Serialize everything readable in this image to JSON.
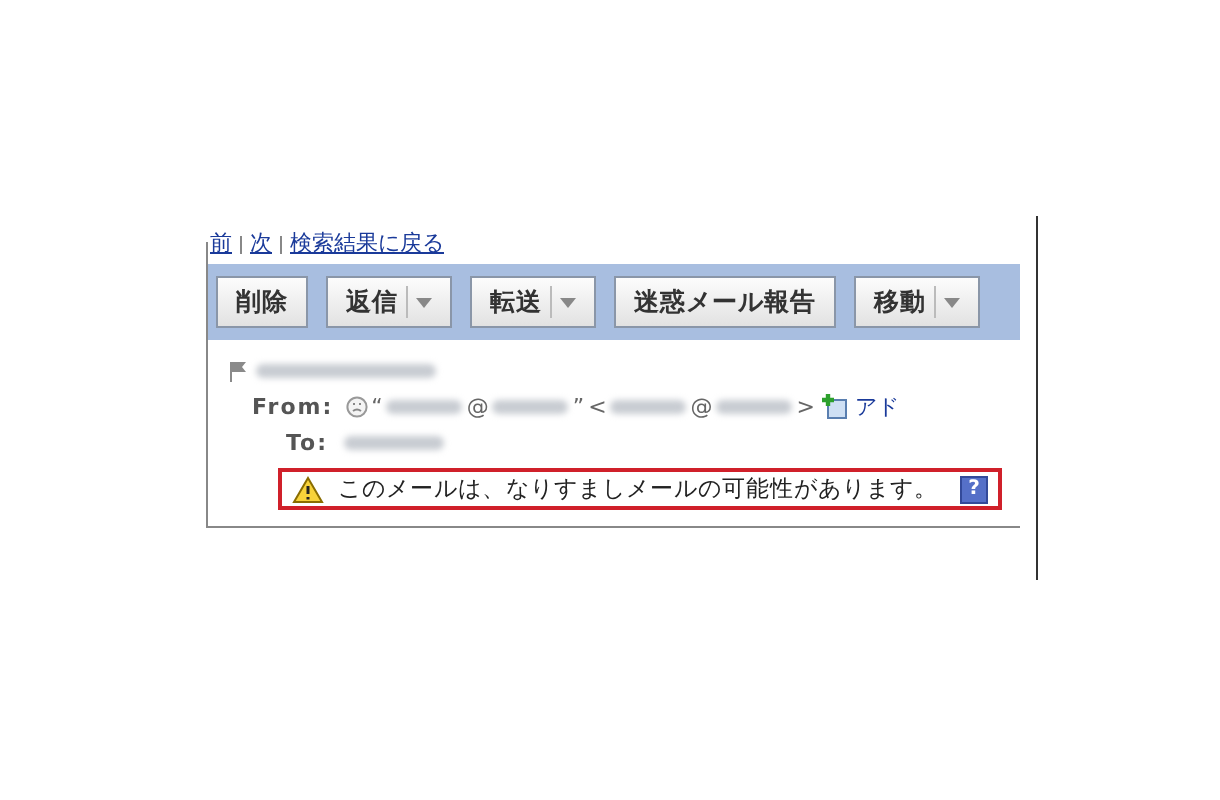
{
  "nav_links": [
    {
      "label": "前"
    },
    {
      "label": "次"
    },
    {
      "label": "検索結果に戻る"
    }
  ],
  "toolbar": {
    "buttons": [
      {
        "label": "削除",
        "dropdown": false
      },
      {
        "label": "返信",
        "dropdown": true
      },
      {
        "label": "転送",
        "dropdown": true
      },
      {
        "label": "迷惑メール報告",
        "dropdown": false
      },
      {
        "label": "移動",
        "dropdown": true
      }
    ]
  },
  "message": {
    "from_label": "From:",
    "from_parts": [
      {
        "kind": "text",
        "text": "“"
      },
      {
        "kind": "blur"
      },
      {
        "kind": "text",
        "text": "@"
      },
      {
        "kind": "blur"
      },
      {
        "kind": "text",
        "text": "”"
      },
      {
        "kind": "text",
        "text": "<"
      },
      {
        "kind": "blur"
      },
      {
        "kind": "text",
        "text": "@"
      },
      {
        "kind": "blur"
      },
      {
        "kind": "text",
        "text": ">"
      }
    ],
    "add_link": "アド",
    "to_label": "To:",
    "warning": {
      "text": "このメールは、なりすましメールの可能性があります。",
      "help": "?"
    }
  }
}
